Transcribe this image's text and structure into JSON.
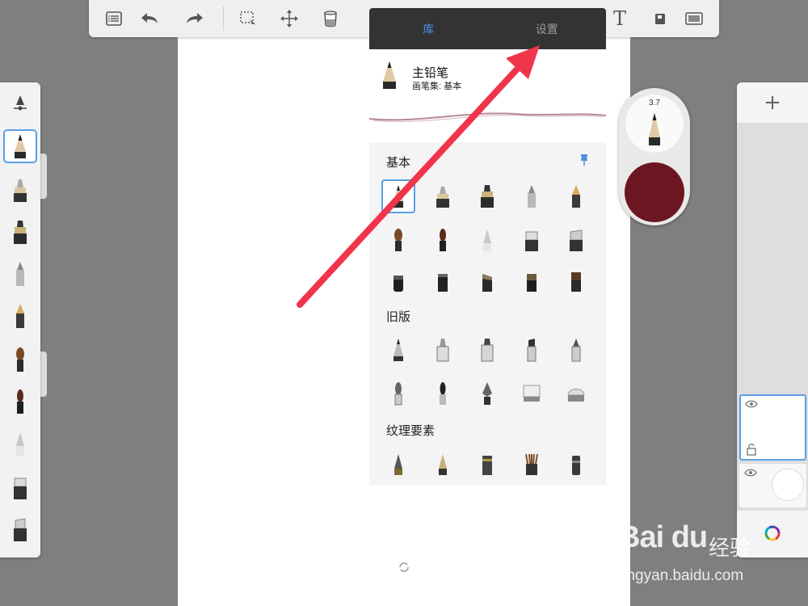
{
  "toolbar": {
    "text_tool_label": "T"
  },
  "popup": {
    "tab_library": "库",
    "tab_settings": "设置",
    "current_brush": {
      "name": "主铅笔",
      "set": "画笔集: 基本"
    },
    "sections": {
      "basic": "基本",
      "legacy": "旧版",
      "texture": "纹理要素"
    }
  },
  "puck": {
    "size": "3.7",
    "color": "#6b1621"
  },
  "right_panel": {
    "add_label": "+"
  },
  "watermark": {
    "logo": "Bai du",
    "jingyan": "经验",
    "url": "jingyan.baidu.com"
  },
  "colors": {
    "accent": "#4a90e2",
    "arrow": "#f0344a"
  }
}
